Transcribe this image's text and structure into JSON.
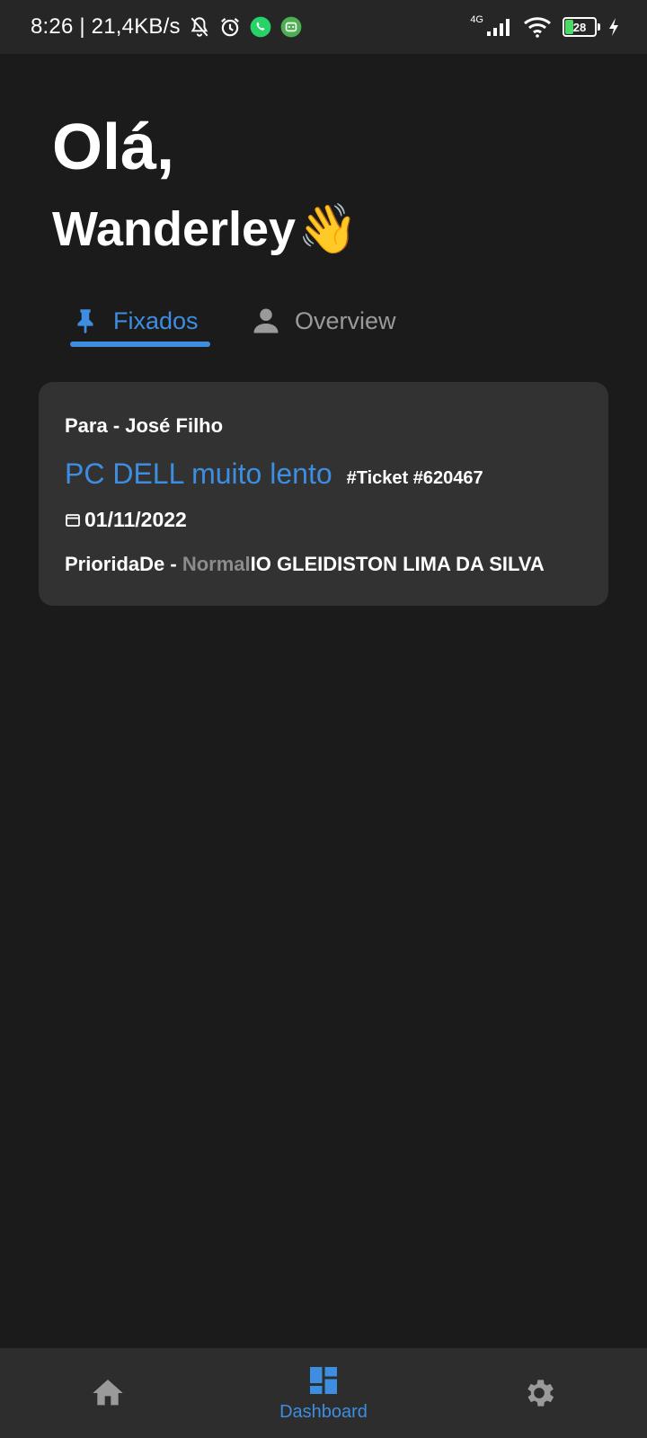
{
  "status_bar": {
    "time_speed": "8:26 | 21,4KB/s",
    "network": "4G",
    "battery": "28"
  },
  "greeting": {
    "line1": "Olá,",
    "name": "Wanderley",
    "emoji": "👋"
  },
  "tabs": [
    {
      "label": "Fixados",
      "icon": "pin-icon",
      "active": true
    },
    {
      "label": "Overview",
      "icon": "person-icon",
      "active": false
    }
  ],
  "ticket_card": {
    "para": "Para - José Filho",
    "title": "PC DELL muito lento",
    "ticket": "#Ticket #620467",
    "date": "01/11/2022",
    "priority_label": "PrioridaDe - ",
    "priority_value": "Normal",
    "assignee": "IO GLEIDISTON LIMA DA SILVA"
  },
  "bottom_nav": {
    "home_icon": "home-icon",
    "dashboard_label": "Dashboard",
    "settings_icon": "gear-icon"
  },
  "colors": {
    "accent": "#3d8ee0",
    "background": "#1b1b1b",
    "card": "#323232"
  }
}
